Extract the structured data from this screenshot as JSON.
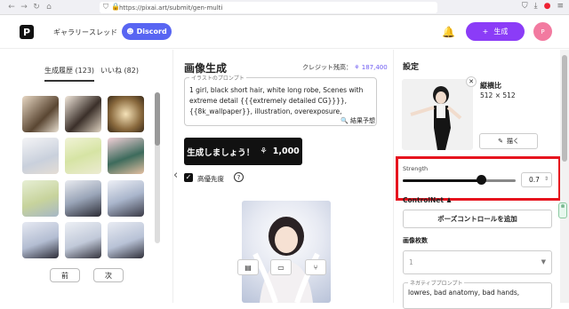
{
  "browser": {
    "url": "https://pixai.art/submit/gen-multi",
    "back": "←",
    "forward": "→",
    "reload": "↻",
    "home": "⌂"
  },
  "header": {
    "logo": "P",
    "nav": [
      "ギャラリー",
      "スレッド"
    ],
    "discord": "Discord",
    "generate": "生成",
    "plus": "+",
    "avatar": "P"
  },
  "history": {
    "tabs": [
      "生成履歴 (123)",
      "いいね (82)"
    ],
    "prev": "前",
    "next": "次"
  },
  "main": {
    "title": "画像生成",
    "credit_label": "クレジット残高：",
    "credit_value": "187,400",
    "prompt_label": "イラストのプロンプト",
    "prompt_text": "1 girl, black short hair, white long robe, Scenes with extreme detail {{{extremely detailed CG}}}}, {{8k_wallpaper}}, illustration, overexposure, dynamic",
    "predict_label": "結果予想",
    "generate_label": "生成しましょう！",
    "generate_cost": "1,000",
    "priority_label": "高優先度",
    "help": "?"
  },
  "settings": {
    "title": "設定",
    "aspect_label": "縦横比",
    "aspect_value": "512 × 512",
    "draw_label": "描く",
    "strength_label": "Strength",
    "strength_value": "0.7",
    "strength_fraction": 0.7,
    "controlnet_label": "ControlNet",
    "pose_button": "ポーズコントロールを追加",
    "count_label": "画像枚数",
    "count_value": "1",
    "negative_label": "ネガティブプロンプト",
    "negative_text": "lowres, bad anatomy, bad hands,"
  },
  "colors": {
    "accent": "#8b3cf7",
    "discord": "#5865f2",
    "highlight": "#e6141e"
  }
}
